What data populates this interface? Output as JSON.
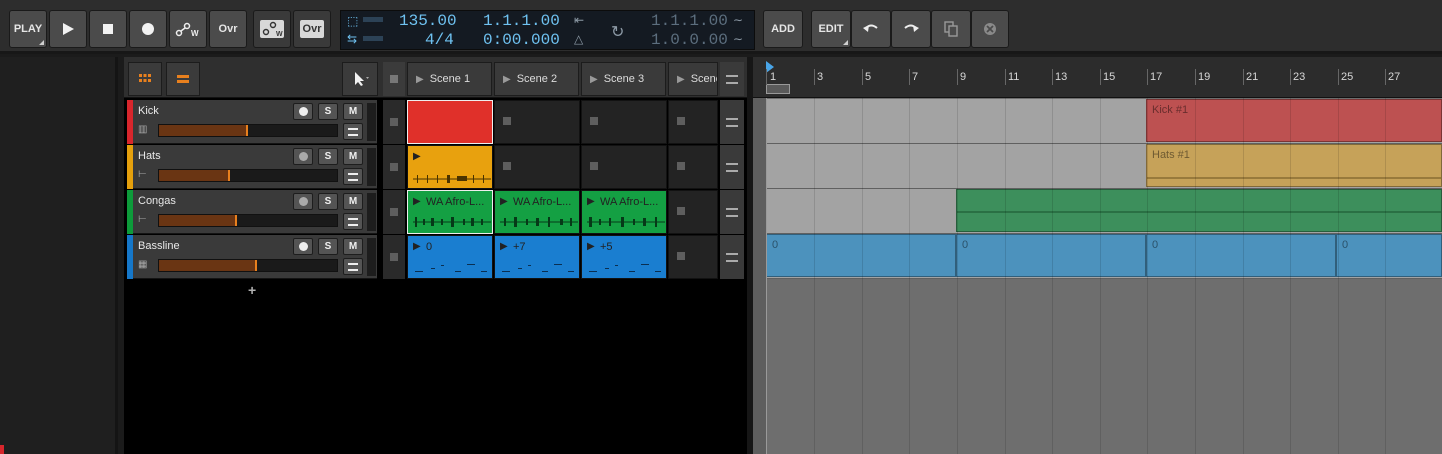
{
  "transport": {
    "play_label": "PLAY",
    "ovr_label": "Ovr",
    "ovr2_label": "Ovr",
    "tempo": "135.00",
    "time_signature": "4/4",
    "position_beats": "1.1.1.00",
    "position_time": "0:00.000",
    "loop_start": "1.1.1.00",
    "loop_length": "1.0.0.00",
    "add_label": "ADD",
    "edit_label": "EDIT",
    "accent_color": "#6fc2f1"
  },
  "tracks": [
    {
      "name": "Kick",
      "color": "#d8262c",
      "volume": 0.5,
      "icon": "drum-machine-icon"
    },
    {
      "name": "Hats",
      "color": "#e5a00c",
      "volume": 0.4,
      "icon": "audio-wave-icon"
    },
    {
      "name": "Congas",
      "color": "#0d9b3a",
      "volume": 0.44,
      "icon": "audio-wave-icon"
    },
    {
      "name": "Bassline",
      "color": "#1577c9",
      "volume": 0.55,
      "icon": "piano-keys-icon"
    }
  ],
  "add_track_label": "+",
  "mute_solo": {
    "solo": "S",
    "mute": "M"
  },
  "scenes": [
    "Scene 1",
    "Scene 2",
    "Scene 3",
    "Scene"
  ],
  "clips": {
    "congas_1": "WA Afro-L...",
    "congas_2": "WA Afro-L...",
    "congas_3": "WA Afro-L...",
    "bass_1": "0",
    "bass_2": "+7",
    "bass_3": "+5"
  },
  "arranger": {
    "bars": [
      "1",
      "3",
      "5",
      "7",
      "9",
      "11",
      "13",
      "15",
      "17",
      "19",
      "21",
      "23",
      "25",
      "27"
    ],
    "kick_clip": "Kick #1",
    "hats_clip": "Hats #1",
    "bass_labels": [
      "0",
      "0",
      "0",
      "0"
    ]
  }
}
